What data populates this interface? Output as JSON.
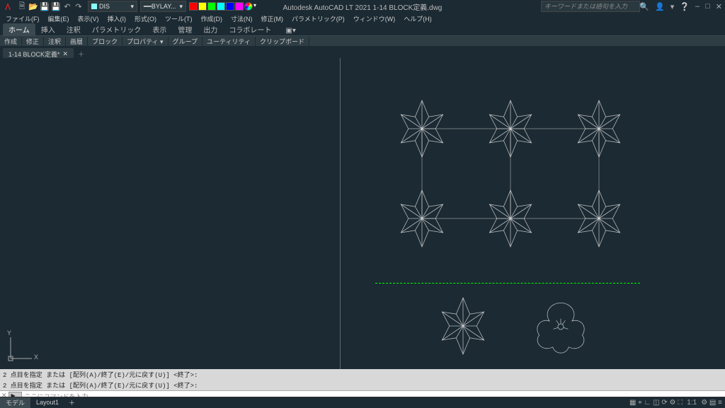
{
  "title": "Autodesk AutoCAD LT 2021   1-14 BLOCK定義.dwg",
  "search_placeholder": "キーワードまたは語句を入力",
  "layer": "DIS",
  "linetype": "BYLAY...",
  "menu": [
    "ファイル(F)",
    "編集(E)",
    "表示(V)",
    "挿入(I)",
    "形式(O)",
    "ツール(T)",
    "作成(D)",
    "寸法(N)",
    "修正(M)",
    "パラメトリック(P)",
    "ウィンドウ(W)",
    "ヘルプ(H)"
  ],
  "ribbon_tabs": [
    "ホーム",
    "挿入",
    "注釈",
    "パラメトリック",
    "表示",
    "管理",
    "出力",
    "コラボレート"
  ],
  "ribbon_panels": [
    "作成",
    "修正",
    "注釈",
    "画層",
    "ブロック",
    "プロパティ ▾",
    "グループ",
    "ユーティリティ",
    "クリップボード"
  ],
  "file_tab": "1-14 BLOCK定義*",
  "ucs": {
    "x": "X",
    "y": "Y"
  },
  "cmd_hist": [
    "2 点目を指定 または [配列(A)/終了(E)/元に戻す(U)] <終了>:",
    "2 点目を指定 または [配列(A)/終了(E)/元に戻す(U)] <終了>:"
  ],
  "cmd_prompt": "▶‗",
  "cmd_input": "ここにコマンドを入力",
  "layout_tabs": [
    "モデル",
    "Layout1"
  ],
  "status_right": {
    "scale": "1:1",
    "other": "▦ ⌖ ∟ ◫ ⟳ ⚙ ⛶"
  },
  "win_ctrls": {
    "min": "–",
    "max": "□",
    "close": "✕"
  },
  "title_icons": {
    "search": "🔍",
    "login": "👤",
    "chev": "▾",
    "help": "❔"
  }
}
